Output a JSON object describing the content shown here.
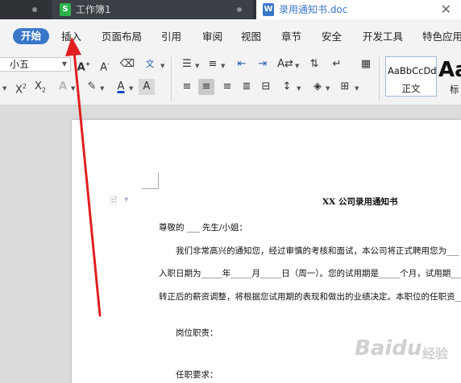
{
  "tabs": [
    {
      "label": ""
    },
    {
      "label": "工作簿1",
      "icon": "spreadsheet-icon",
      "icon_glyph": "S"
    },
    {
      "label": "录用通知书.doc",
      "icon": "word-doc-icon",
      "icon_glyph": "W"
    }
  ],
  "menu": {
    "items": [
      "开始",
      "插入",
      "页面布局",
      "引用",
      "审阅",
      "视图",
      "章节",
      "安全",
      "开发工具",
      "特色应用"
    ],
    "active_index": 0,
    "active_color": "#3a77c9"
  },
  "ribbon": {
    "font_size_value": "小五",
    "style_normal_sample": "AaBbCcDd",
    "style_normal_name": "正文",
    "style_heading_sample": "Aa",
    "style_heading_name": "标"
  },
  "document": {
    "title": "XX 公司录用通知书",
    "lines": [
      "尊敬的 ___ 先生/小姐：",
      "我们非常高兴的通知您，经过审慎的考核和面试，本公司将正式聘用您为___",
      "入职日期为_____年_____月_____日（周一）。您的试用期是_____个月，试用期___",
      "转正后的薪资调整，将根据您试用期的表现和做出的业绩决定。本职位的任职资___",
      "岗位职责：",
      "任职要求："
    ]
  },
  "watermark": {
    "text_main": "Baidu",
    "text_sub": "经验"
  },
  "annotation_color": "#e02020"
}
